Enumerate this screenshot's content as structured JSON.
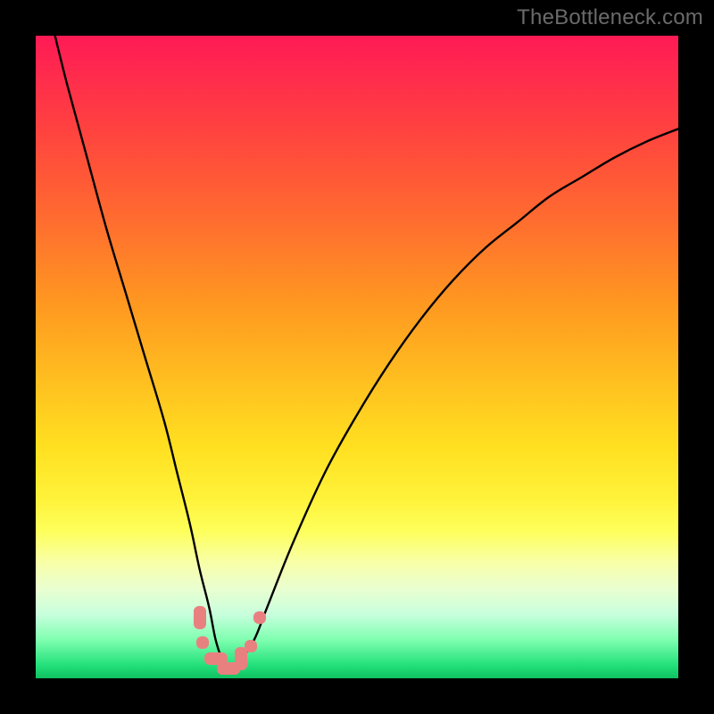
{
  "watermark": "TheBottleneck.com",
  "colors": {
    "curve_stroke": "#000000",
    "marker_fill": "#e98080",
    "frame_bg": "#000000"
  },
  "chart_data": {
    "type": "line",
    "title": "",
    "xlabel": "",
    "ylabel": "",
    "xlim": [
      0,
      100
    ],
    "ylim": [
      0,
      100
    ],
    "grid": false,
    "legend": false,
    "series": [
      {
        "name": "bottleneck-curve",
        "x": [
          3,
          5,
          8,
          11,
          14,
          17,
          20,
          22,
          24,
          25.5,
          27,
          28,
          29,
          30,
          31,
          32,
          34,
          36,
          40,
          45,
          50,
          55,
          60,
          65,
          70,
          75,
          80,
          85,
          90,
          95,
          100
        ],
        "y": [
          100,
          92,
          81,
          70,
          60,
          50,
          40,
          32,
          24,
          17,
          11,
          6,
          3,
          1.5,
          1.5,
          3,
          6,
          11,
          21,
          32,
          41,
          49,
          56,
          62,
          67,
          71,
          75,
          78,
          81,
          83.5,
          85.5
        ]
      }
    ],
    "markers": [
      {
        "x": 25.5,
        "y": 9.5,
        "shape": "pill-v"
      },
      {
        "x": 26.0,
        "y": 5.5,
        "shape": "dot"
      },
      {
        "x": 28.0,
        "y": 3.0,
        "shape": "pill-h"
      },
      {
        "x": 30.0,
        "y": 1.5,
        "shape": "pill-h"
      },
      {
        "x": 32.0,
        "y": 3.0,
        "shape": "pill-v"
      },
      {
        "x": 33.5,
        "y": 5.0,
        "shape": "dot"
      },
      {
        "x": 34.8,
        "y": 9.5,
        "shape": "dot"
      }
    ]
  }
}
